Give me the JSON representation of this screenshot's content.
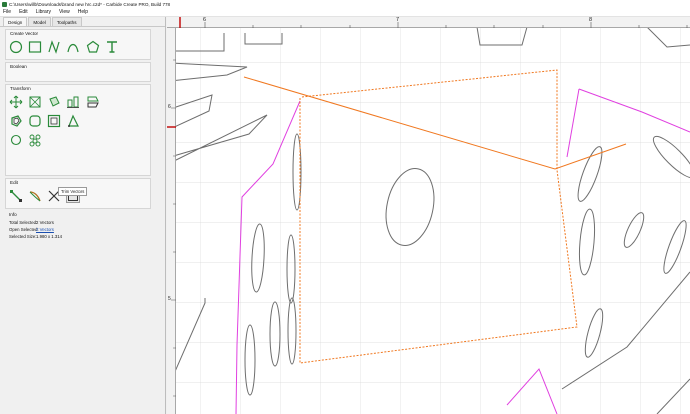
{
  "window": {
    "title": "C:\\Users\\willb\\Downloads\\brand new hrc.c2d* - Carbide Create PRO, Build 778"
  },
  "menu": [
    "File",
    "Edit",
    "Library",
    "View",
    "Help"
  ],
  "tabs": [
    "Design",
    "Model",
    "Toolpaths"
  ],
  "panels": {
    "create_vector": "Create Vector",
    "boolean": "Boolean",
    "transform": "Transform",
    "edit": "Edit",
    "info": "Info"
  },
  "tooltip": "Trim Vectors",
  "info": {
    "total_selected_label": "Total Selected:",
    "total_selected_value": "2 Vectors",
    "open_selected_label": "Open Selected:",
    "open_selected_value": "2 Vectors",
    "selected_size_label": "Selected Size:",
    "selected_size_value": "1.980 x 1.314"
  },
  "rulers": {
    "horizontal": [
      "6",
      "7",
      "8"
    ],
    "vertical": [
      "6",
      "5"
    ]
  },
  "colors": {
    "selected_vector": "#f07820",
    "magenta_vector": "#e040e0",
    "grid": "#d8d8d8",
    "ruler_marker": "#c00000",
    "icon_green": "#2a8a3a"
  }
}
